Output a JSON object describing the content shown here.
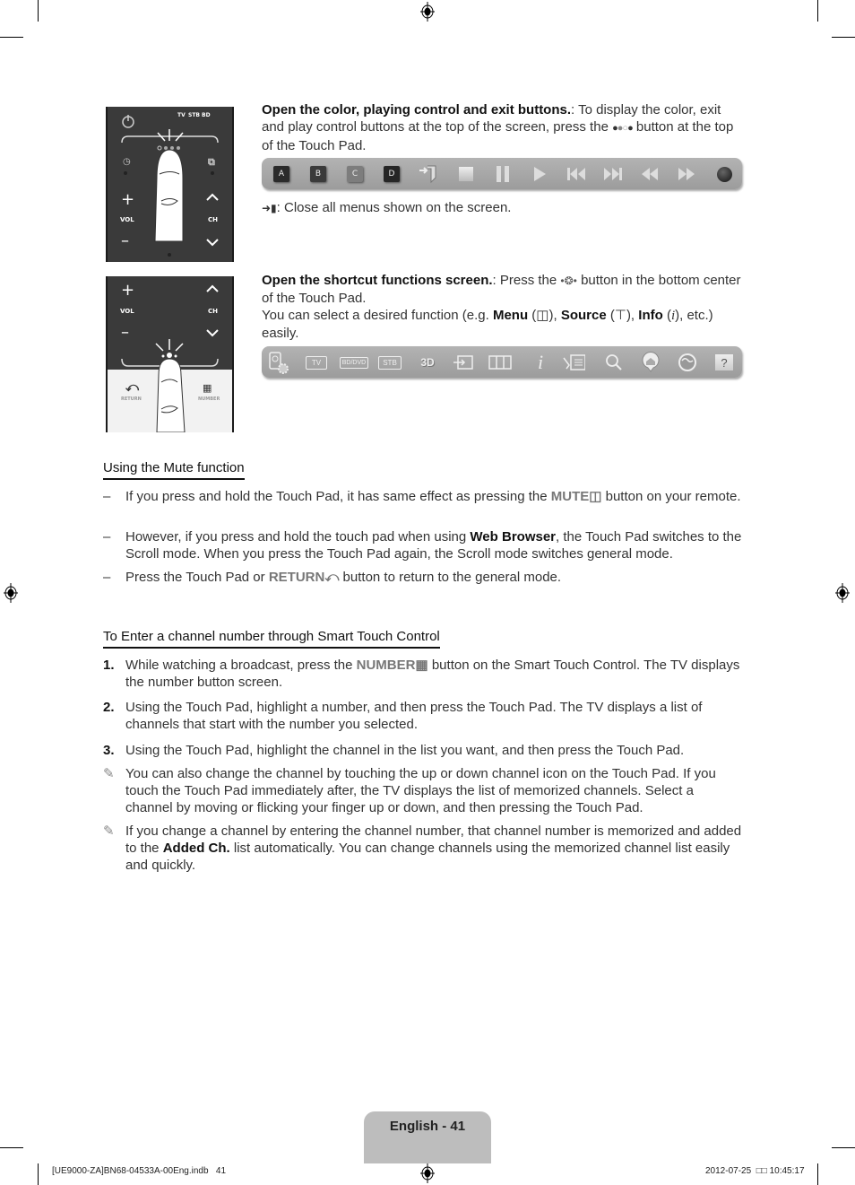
{
  "section1": {
    "title_bold": "Open the color, playing control and exit buttons.",
    "text_a": ": To display the color, exit and play control buttons at the top of the screen, press the",
    "text_b": "button at the top of the Touch Pad.",
    "exit_note": ": Close all menus shown on the screen.",
    "toolbar": [
      {
        "icon": "color-a-button",
        "label": "A",
        "color": "#2b2b2b"
      },
      {
        "icon": "color-b-button",
        "label": "B",
        "color": "#3a3a3a"
      },
      {
        "icon": "color-c-button",
        "label": "C",
        "color": "#7d7d7d"
      },
      {
        "icon": "color-d-button",
        "label": "D",
        "color": "#262626"
      },
      {
        "icon": "exit-icon"
      },
      {
        "icon": "stop-icon"
      },
      {
        "icon": "pause-icon"
      },
      {
        "icon": "play-icon"
      },
      {
        "icon": "previous-icon"
      },
      {
        "icon": "next-icon"
      },
      {
        "icon": "rewind-icon"
      },
      {
        "icon": "fast-forward-icon"
      },
      {
        "icon": "record-icon"
      }
    ]
  },
  "remote1": {
    "tv": "TV",
    "stb": "STB",
    "bd": "BD",
    "vol": "VOL",
    "ch": "CH"
  },
  "remote2": {
    "vol": "VOL",
    "ch": "CH",
    "return": "RETURN",
    "number": "NUMBER"
  },
  "section2": {
    "title_bold": "Open the shortcut functions screen.",
    "text_a": ": Press the",
    "text_b": "button in the bottom center of the Touch Pad.",
    "text_c": "You can select a desired function (e.g.",
    "menu": "Menu",
    "source": "Source",
    "info": "Info",
    "text_d": "etc.) easily.",
    "toolbar": [
      {
        "icon": "power-settings-icon"
      },
      {
        "icon": "tv-icon",
        "label": "TV"
      },
      {
        "icon": "bd-dvd-icon",
        "label": "BD/DVD"
      },
      {
        "icon": "stb-icon",
        "label": "STB"
      },
      {
        "icon": "3d-icon",
        "label": "3D"
      },
      {
        "icon": "source-icon"
      },
      {
        "icon": "menu-icon"
      },
      {
        "icon": "info-icon",
        "label": "i"
      },
      {
        "icon": "tools-icon"
      },
      {
        "icon": "search-icon"
      },
      {
        "icon": "smart-hub-icon"
      },
      {
        "icon": "internet-icon"
      },
      {
        "icon": "help-icon",
        "label": "?"
      }
    ]
  },
  "mute": {
    "heading": "Using the Mute function",
    "items": [
      {
        "a": "If you press and hold the Touch Pad, it has same effect as pressing the",
        "key": "MUTE",
        "b": "button on your remote."
      },
      {
        "a": "However, if you press and hold the touch pad when using",
        "bold": "Web Browser",
        "b": ", the Touch Pad switches to the Scroll mode. When you press the Touch Pad again, the Scroll mode switches general mode."
      },
      {
        "a": "Press the Touch Pad or",
        "key": "RETURN",
        "b": "button to return to the general mode."
      }
    ]
  },
  "channel": {
    "heading": "To Enter a channel number through Smart Touch Control",
    "steps": [
      {
        "num": "1.",
        "a": "While watching a broadcast, press the",
        "key": "NUMBER",
        "b": "button on the Smart Touch Control. The TV displays the number button screen."
      },
      {
        "num": "2.",
        "a": "Using the Touch Pad, highlight a number, and then press the Touch Pad. The TV displays a list of channels that start with the number you selected."
      },
      {
        "num": "3.",
        "a": "Using the Touch Pad, highlight the channel in the list you want, and then press the Touch Pad."
      }
    ],
    "notes": [
      {
        "a": "You can also change the channel by touching the up or down channel icon on the Touch Pad. If you touch the Touch Pad immediately after, the TV displays the list of memorized channels. Select a channel by moving or flicking your finger up or down, and then pressing the Touch Pad."
      },
      {
        "a": "If you change a channel by entering the channel number, that channel number is memorized and added to the",
        "bold": "Added Ch.",
        "b": "list automatically. You can change channels using the memorized channel list easily and quickly."
      }
    ]
  },
  "footer": {
    "page_label": "English - 41",
    "file": "[UE9000-ZA]BN68-04533A-00Eng.indb   41",
    "date": "2012-07-25",
    "time_prefix": "□□",
    "time": "10:45:17"
  }
}
